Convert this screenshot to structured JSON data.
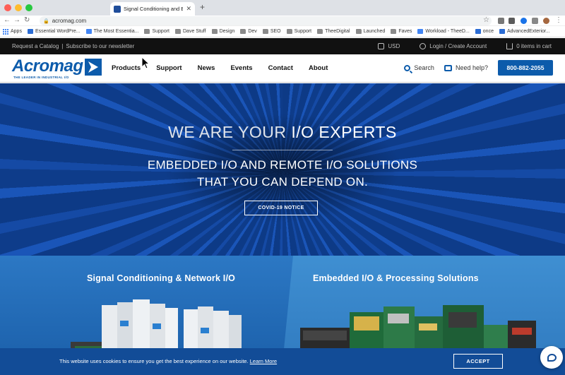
{
  "browser": {
    "tab_title": "Signal Conditioning and Embedd",
    "url": "acromag.com",
    "bookmarks": [
      {
        "label": "Apps",
        "icon": "apps-icon"
      },
      {
        "label": "Essential WordPre...",
        "icon": "bookmark-icon"
      },
      {
        "label": "The Most Essentia...",
        "icon": "doc-icon"
      },
      {
        "label": "Support",
        "icon": "folder-icon"
      },
      {
        "label": "Dave Stuff",
        "icon": "folder-icon"
      },
      {
        "label": "Design",
        "icon": "folder-icon"
      },
      {
        "label": "Dev",
        "icon": "folder-icon"
      },
      {
        "label": "SEO",
        "icon": "folder-icon"
      },
      {
        "label": "Support",
        "icon": "folder-icon"
      },
      {
        "label": "TheeDigital",
        "icon": "folder-icon"
      },
      {
        "label": "Launched",
        "icon": "folder-icon"
      },
      {
        "label": "Faves",
        "icon": "folder-icon"
      },
      {
        "label": "Workload - TheeD...",
        "icon": "doc-icon"
      },
      {
        "label": "once",
        "icon": "bookmark-icon"
      },
      {
        "label": "AdvancedExterior...",
        "icon": "bookmark-icon"
      }
    ]
  },
  "utility": {
    "request_catalog": "Request a Catalog",
    "separator": "|",
    "subscribe": "Subscribe to our newsletter",
    "currency": "USD",
    "account": "Login / Create Account",
    "cart": "0 items in cart"
  },
  "header": {
    "logo_text": "Acromag",
    "logo_tagline": "THE LEADER IN INDUSTRIAL I/O",
    "nav": [
      "Products",
      "Support",
      "News",
      "Events",
      "Contact",
      "About"
    ],
    "search_label": "Search",
    "help_label": "Need help?",
    "phone": "800-882-2055"
  },
  "hero": {
    "title_part1": "WE ARE YOUR ",
    "title_part2": "I/O EXPERTS",
    "subtitle_line1": "EMBEDDED I/O AND REMOTE I/O SOLUTIONS",
    "subtitle_line2": "THAT YOU CAN DEPEND ON.",
    "button": "COVID-19 NOTICE"
  },
  "panels": {
    "left_title": "Signal Conditioning & Network I/O",
    "right_title": "Embedded I/O & Processing Solutions"
  },
  "cookie": {
    "text": "This website uses cookies to ensure you get the best experience on our website.",
    "link": "Learn More",
    "accept": "ACCEPT"
  },
  "colors": {
    "brand_blue": "#0c5bab",
    "hero_blue": "#10418f",
    "cookie_bar": "#124c97"
  }
}
